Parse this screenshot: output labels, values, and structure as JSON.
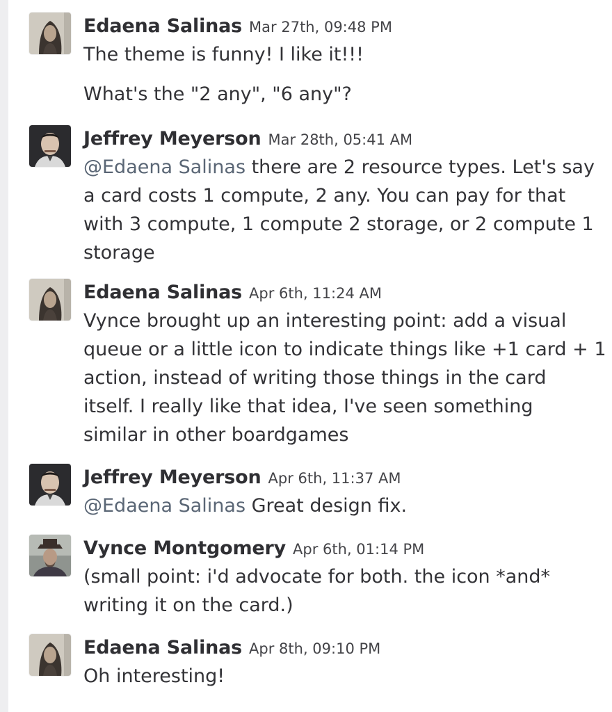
{
  "messages": [
    {
      "author": "Edaena Salinas",
      "timestamp": "Mar 27th, 09:48 PM",
      "avatar": "edaena-avatar",
      "text_lines": [
        "The theme is funny! I like it!!!",
        "What's the \"2 any\", \"6 any\"?"
      ]
    },
    {
      "author": "Jeffrey Meyerson",
      "timestamp": "Mar 28th, 05:41 AM",
      "avatar": "jeffrey-avatar",
      "mention": "@Edaena Salinas",
      "text_lines": [
        " there are 2 resource types. Let's say",
        "a card costs 1 compute, 2 any. You can pay for that",
        "with 3 compute, 1 compute 2 storage, or 2 compute 1",
        "storage"
      ]
    },
    {
      "author": "Edaena Salinas",
      "timestamp": "Apr 6th, 11:24 AM",
      "avatar": "edaena-avatar",
      "text_lines": [
        "Vynce brought up an interesting point: add a visual",
        "queue or a little icon to indicate things like +1 card + 1",
        "action, instead of writing those things in the card",
        "itself. I really like that idea, I've seen something",
        "similar in other boardgames"
      ]
    },
    {
      "author": "Jeffrey Meyerson",
      "timestamp": "Apr 6th, 11:37 AM",
      "avatar": "jeffrey-avatar",
      "mention": "@Edaena Salinas",
      "text_lines": [
        " Great design fix."
      ]
    },
    {
      "author": "Vynce Montgomery",
      "timestamp": "Apr 6th, 01:14 PM",
      "avatar": "vynce-avatar",
      "text_lines": [
        "(small point: i'd advocate for both. the icon *and*",
        "writing it on the card.)"
      ]
    },
    {
      "author": "Edaena Salinas",
      "timestamp": "Apr 8th, 09:10 PM",
      "avatar": "edaena-avatar",
      "text_lines": [
        "Oh interesting!"
      ]
    }
  ],
  "colors": {
    "mention": "#5a6675",
    "author": "#2f2f33",
    "text": "#333337",
    "rail": "#eeeef0"
  }
}
